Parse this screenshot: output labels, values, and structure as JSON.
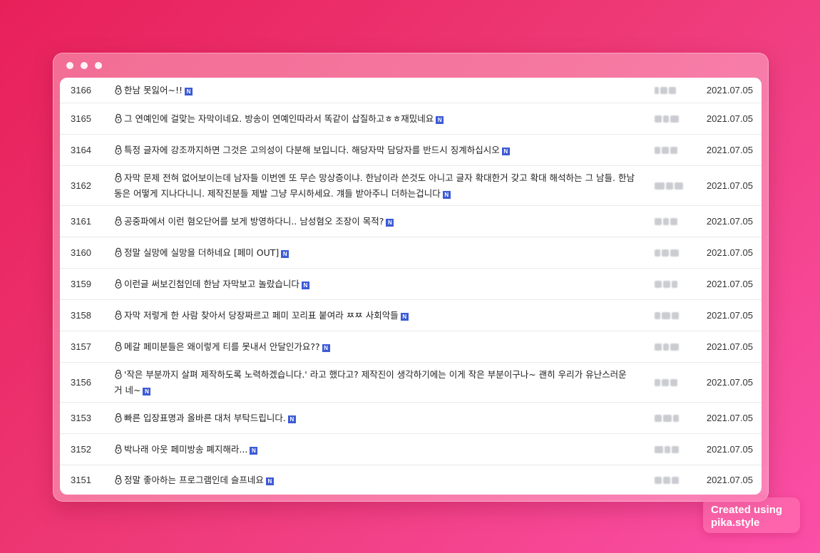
{
  "posts": [
    {
      "num": "3166",
      "title": "한남 못잃어~!!",
      "date": "2021.07.05"
    },
    {
      "num": "3165",
      "title": "그 연예인에 걸맞는 자막이네요. 방송이 연예인따라서 똑같이 삽질하고ㅎㅎ재밌네요",
      "date": "2021.07.05"
    },
    {
      "num": "3164",
      "title": "특정 글자에 강조까지하면 그것은 고의성이 다분해 보입니다. 해당자막 담당자를 반드시 징계하십시오",
      "date": "2021.07.05"
    },
    {
      "num": "3162",
      "title": "자막 문제 전혀 없어보이는데 남자들 이번엔 또 무슨 망상증이냐. 한남이라 쓴것도 아니고 글자 확대한거 갖고 확대 해석하는 그 남들. 한남 동은 어떻게 지나다니니. 제작진분들 제발 그냥 무시하세요. 걔들 받아주니 더하는겁니다",
      "date": "2021.07.05"
    },
    {
      "num": "3161",
      "title": "공중파에서 이런 혐오단어를 보게 방영하다니.. 남성혐오 조장이 목적?",
      "date": "2021.07.05"
    },
    {
      "num": "3160",
      "title": "정말 실망에 실망을 더하네요 [페미 OUT]",
      "date": "2021.07.05"
    },
    {
      "num": "3159",
      "title": "이런글 써보긴첨인데 한남 자막보고 놀랐습니다",
      "date": "2021.07.05"
    },
    {
      "num": "3158",
      "title": "자막 저렇게 한 사람 찾아서 당장짜르고 페미 꼬리표 붙여라 ㅉㅉ 사회악들",
      "date": "2021.07.05"
    },
    {
      "num": "3157",
      "title": "메갈 페미분들은 왜이렇게 티를 못내서 안달인가요??",
      "date": "2021.07.05"
    },
    {
      "num": "3156",
      "title": "'작은 부분까지 살펴 제작하도록 노력하겠습니다.' 라고 했다고? 제작진이 생각하기에는 이게 작은 부분이구나~ 괜히 우리가 유난스러운거 네~",
      "date": "2021.07.05"
    },
    {
      "num": "3153",
      "title": "빠른 입장표명과 올바른 대처 부탁드립니다.",
      "date": "2021.07.05"
    },
    {
      "num": "3152",
      "title": "박나래 아웃 페미방송 폐지해라...",
      "date": "2021.07.05"
    },
    {
      "num": "3151",
      "title": "정말 좋아하는 프로그램인데 슬프네요",
      "date": "2021.07.05"
    }
  ],
  "new_badge": "N",
  "watermark": {
    "line1": "Created using",
    "line2": "pika.style"
  }
}
